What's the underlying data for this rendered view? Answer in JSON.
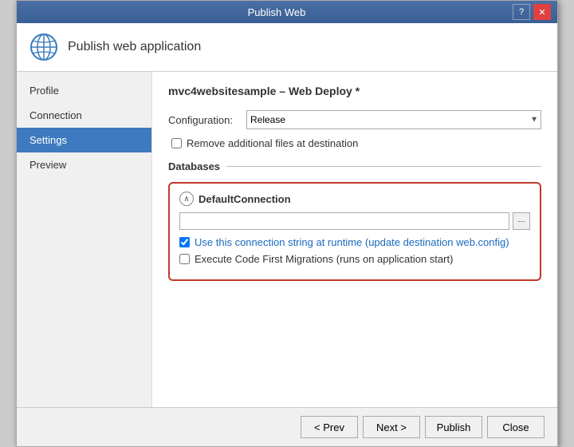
{
  "titleBar": {
    "title": "Publish Web",
    "helpBtn": "?",
    "closeBtn": "✕"
  },
  "header": {
    "icon": "globe",
    "title": "Publish web application"
  },
  "sidebar": {
    "items": [
      {
        "id": "profile",
        "label": "Profile"
      },
      {
        "id": "connection",
        "label": "Connection"
      },
      {
        "id": "settings",
        "label": "Settings"
      },
      {
        "id": "preview",
        "label": "Preview"
      }
    ],
    "activeItem": "settings"
  },
  "main": {
    "deployTitle": "mvc4websitesample – Web Deploy *",
    "configLabel": "Configuration:",
    "configValue": "Release",
    "removeFilesLabel": "Remove additional files at destination",
    "databasesLabel": "Databases",
    "defaultConnection": {
      "name": "DefaultConnection",
      "connectionStringLabel": "Use this connection string at runtime (update destination web.config)",
      "connectionStringChecked": true,
      "migrationsLabel": "Execute Code First Migrations (runs on application start)",
      "migrationsChecked": false
    }
  },
  "footer": {
    "prevBtn": "< Prev",
    "nextBtn": "Next >",
    "publishBtn": "Publish",
    "closeBtn": "Close"
  }
}
